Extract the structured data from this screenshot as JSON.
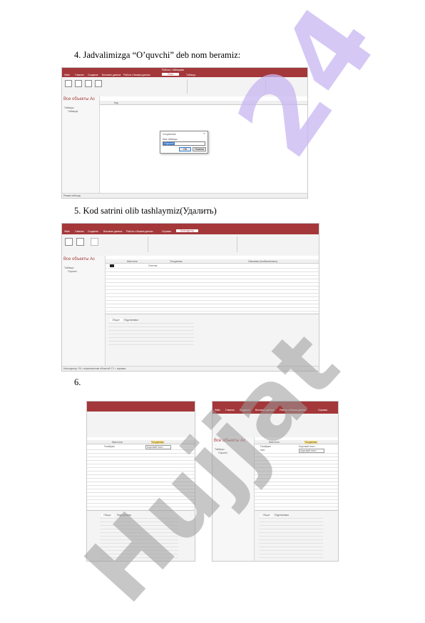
{
  "steps": [
    {
      "number": "4.",
      "text": "Jadvalimizga “O’quvchi” deb nom beramiz:"
    },
    {
      "number": "5.",
      "text": "Kod satrini olib tashlaymiz(Удалить)"
    },
    {
      "number": "6.",
      "text": ""
    }
  ],
  "shot1": {
    "window_title": "Работа с таблицами",
    "tabs": [
      "Файл",
      "Главная",
      "Создание",
      "Внешние данные",
      "Работа с базами данных",
      "Поля",
      "Таблица"
    ],
    "nav_title": "Все объекты Ac",
    "nav_items": [
      "Таблицы",
      "Таблица1"
    ],
    "column_header": "Код",
    "dialog": {
      "title": "Сохранение",
      "label": "Имя таблицы:",
      "value": "O'quvchi",
      "ok": "ОК",
      "cancel": "Отмена"
    },
    "status_left": "Режим таблицы"
  },
  "shot2": {
    "tabs": [
      "Файл",
      "Главная",
      "Создание",
      "Внешние данные",
      "Работа с базами данных",
      "Справка",
      "Конструктор"
    ],
    "nav_title": "Все объекты Ac",
    "nav_items": [
      "Таблицы",
      "O'quvchi"
    ],
    "field_headers": [
      "Имя поля",
      "Тип данных",
      "Описание (необязательно)"
    ],
    "row_type": "Счетчик",
    "props_tabs": [
      "Общие",
      "Подстановка"
    ],
    "status_left": "Конструктор. F6 = переключение областей. F1 = справка."
  },
  "shot3": {
    "field_headers": [
      "Имя поля",
      "Тип данных"
    ],
    "row": {
      "name": "Familiyasi",
      "type": "Короткий текст"
    },
    "props_tabs": [
      "Общие",
      "Подстановка"
    ]
  },
  "shot4": {
    "tabs": [
      "Файл",
      "Главная",
      "Создание",
      "Внешние данные",
      "Работа с базами данных",
      "Справка"
    ],
    "nav_title": "Все объекты Ac",
    "nav_items": [
      "Таблицы",
      "O'quvchi"
    ],
    "field_headers": [
      "Имя поля",
      "Тип данных"
    ],
    "rows": [
      {
        "name": "Familiyasi",
        "type": "Короткий текст"
      },
      {
        "name": "Ismi",
        "type": "Короткий текст"
      }
    ],
    "props_tabs": [
      "Общие",
      "Подстановка"
    ]
  },
  "watermark": {
    "text": "Hujjat24",
    "color_purple": "#c9b6f2",
    "color_gray": "#9a9a9a"
  }
}
